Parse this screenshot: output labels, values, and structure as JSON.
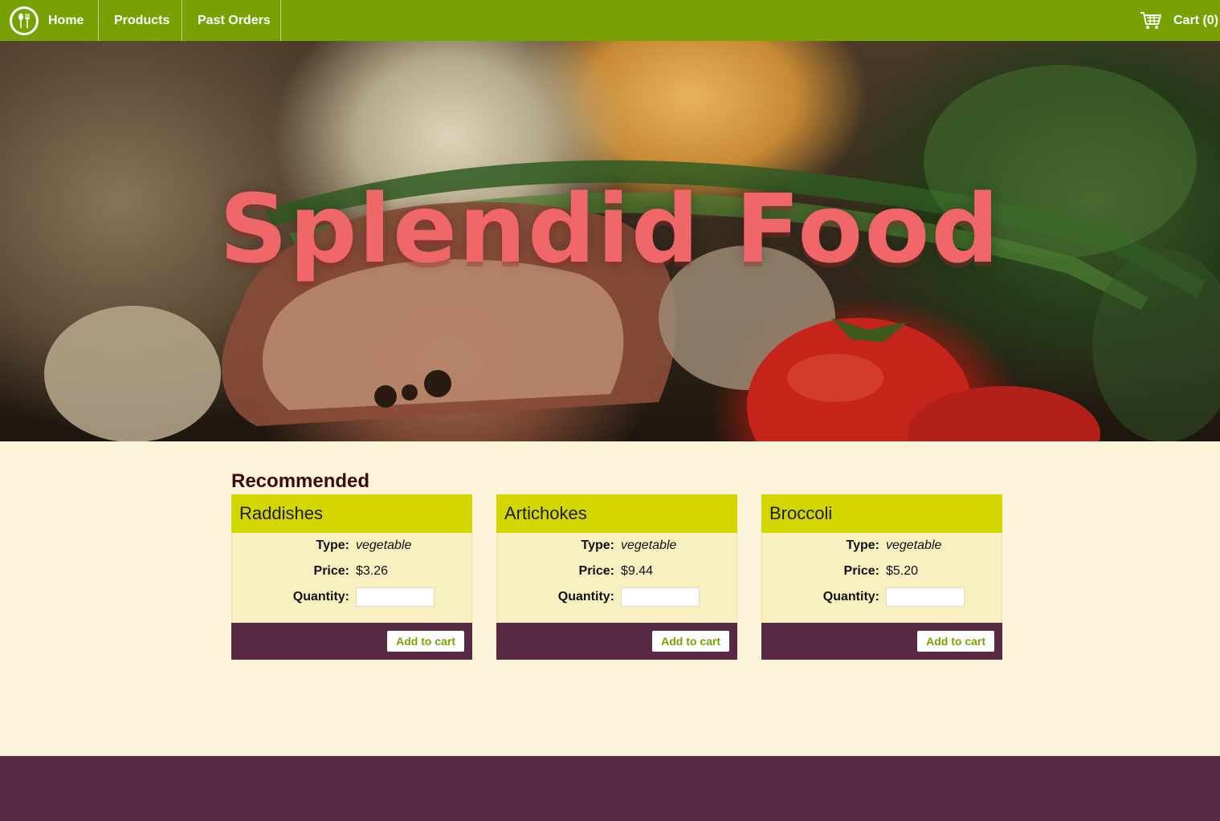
{
  "nav": {
    "home_label": "Home",
    "products_label": "Products",
    "past_orders_label": "Past Orders",
    "cart_label": "Cart (0)",
    "logo_icon": "fork-and-spoon-icon",
    "cart_icon": "shopping-cart-icon"
  },
  "hero": {
    "title": "Splendid Food"
  },
  "recommended": {
    "heading": "Recommended",
    "type_label": "Type:",
    "price_label": "Price:",
    "quantity_label": "Quantity:",
    "add_button_label": "Add to cart",
    "products": [
      {
        "name": "Raddishes",
        "type": "vegetable",
        "price": "$3.26",
        "quantity": ""
      },
      {
        "name": "Artichokes",
        "type": "vegetable",
        "price": "$9.44",
        "quantity": ""
      },
      {
        "name": "Broccoli",
        "type": "vegetable",
        "price": "$5.20",
        "quantity": ""
      }
    ]
  },
  "colors": {
    "nav_bg": "#78a204",
    "hero_title": "#f0676a",
    "card_header": "#d4d600",
    "card_body": "#f9f0c2",
    "card_footer": "#582942",
    "page_bg": "#fcf4d8",
    "footer_bg": "#582942"
  }
}
